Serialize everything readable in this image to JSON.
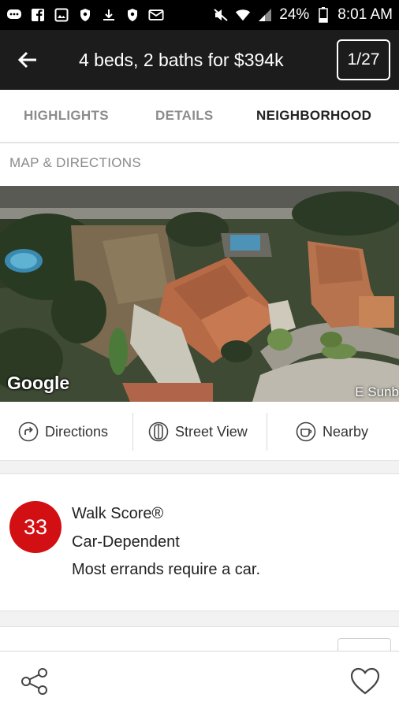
{
  "status_bar": {
    "battery": "24%",
    "time": "8:01 AM",
    "icons_left": [
      "chat-icon",
      "facebook-icon",
      "image-icon",
      "shield-icon",
      "download-icon",
      "shield-icon",
      "mail-icon"
    ],
    "icons_right": [
      "mute-icon",
      "wifi-icon",
      "signal-icon",
      "battery-icon"
    ]
  },
  "app_bar": {
    "title": "4 beds, 2 baths for $394k",
    "counter": "1/27"
  },
  "tabs": [
    {
      "label": "HIGHLIGHTS",
      "active": false
    },
    {
      "label": "DETAILS",
      "active": false
    },
    {
      "label": "NEIGHBORHOOD",
      "active": true
    }
  ],
  "map_section": {
    "label": "MAP & DIRECTIONS",
    "provider": "Google",
    "street": "E Sunb"
  },
  "actions": [
    {
      "label": "Directions",
      "icon": "directions-icon"
    },
    {
      "label": "Street View",
      "icon": "street-view-icon"
    },
    {
      "label": "Nearby",
      "icon": "nearby-icon"
    }
  ],
  "walk_score": {
    "score": "33",
    "title": "Walk Score®",
    "category": "Car-Dependent",
    "description": "Most errands require a car.",
    "color": "#d20f12"
  },
  "bottom_bar": {
    "share_icon": "share-icon",
    "favorite_icon": "heart-icon"
  }
}
